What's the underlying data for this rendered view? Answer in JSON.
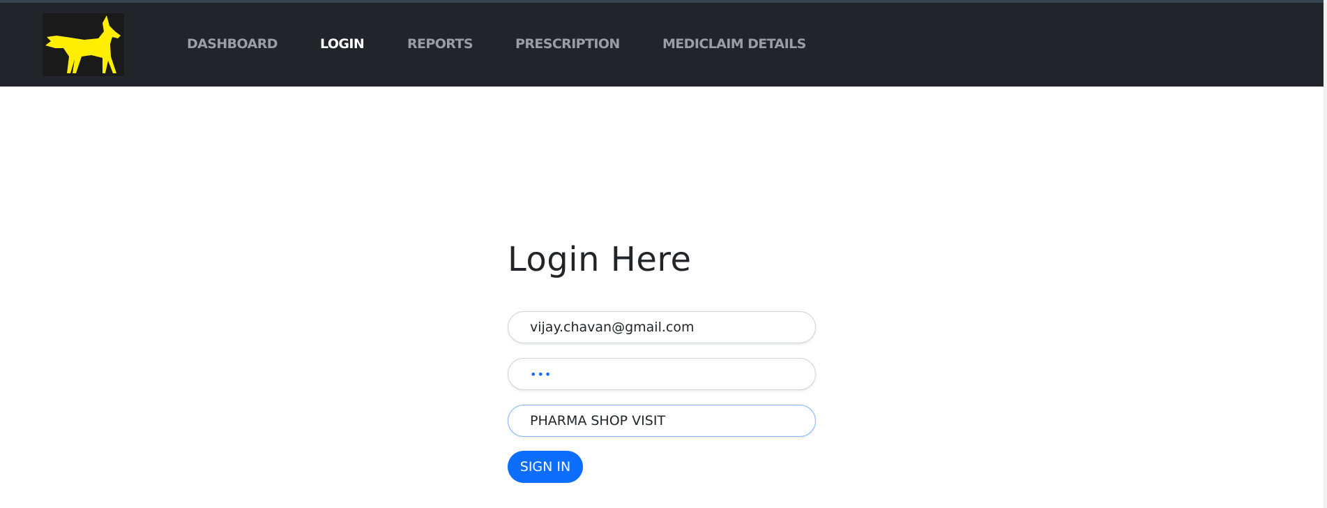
{
  "navbar": {
    "logo": "fox-logo",
    "items": [
      {
        "label": "DASHBOARD",
        "active": false
      },
      {
        "label": "LOGIN",
        "active": true
      },
      {
        "label": "REPORTS",
        "active": false
      },
      {
        "label": "PRESCRIPTION",
        "active": false
      },
      {
        "label": "MEDICLAIM DETAILS",
        "active": false
      }
    ]
  },
  "login": {
    "title": "Login Here",
    "email_value": "vijay.chavan@gmail.com",
    "password_value": "abc",
    "purpose_value": "PHARMA SHOP VISIT",
    "submit_label": "SIGN IN"
  },
  "colors": {
    "navbar": "#212529",
    "accent": "#0d6efd",
    "logo": "#ffee00"
  }
}
